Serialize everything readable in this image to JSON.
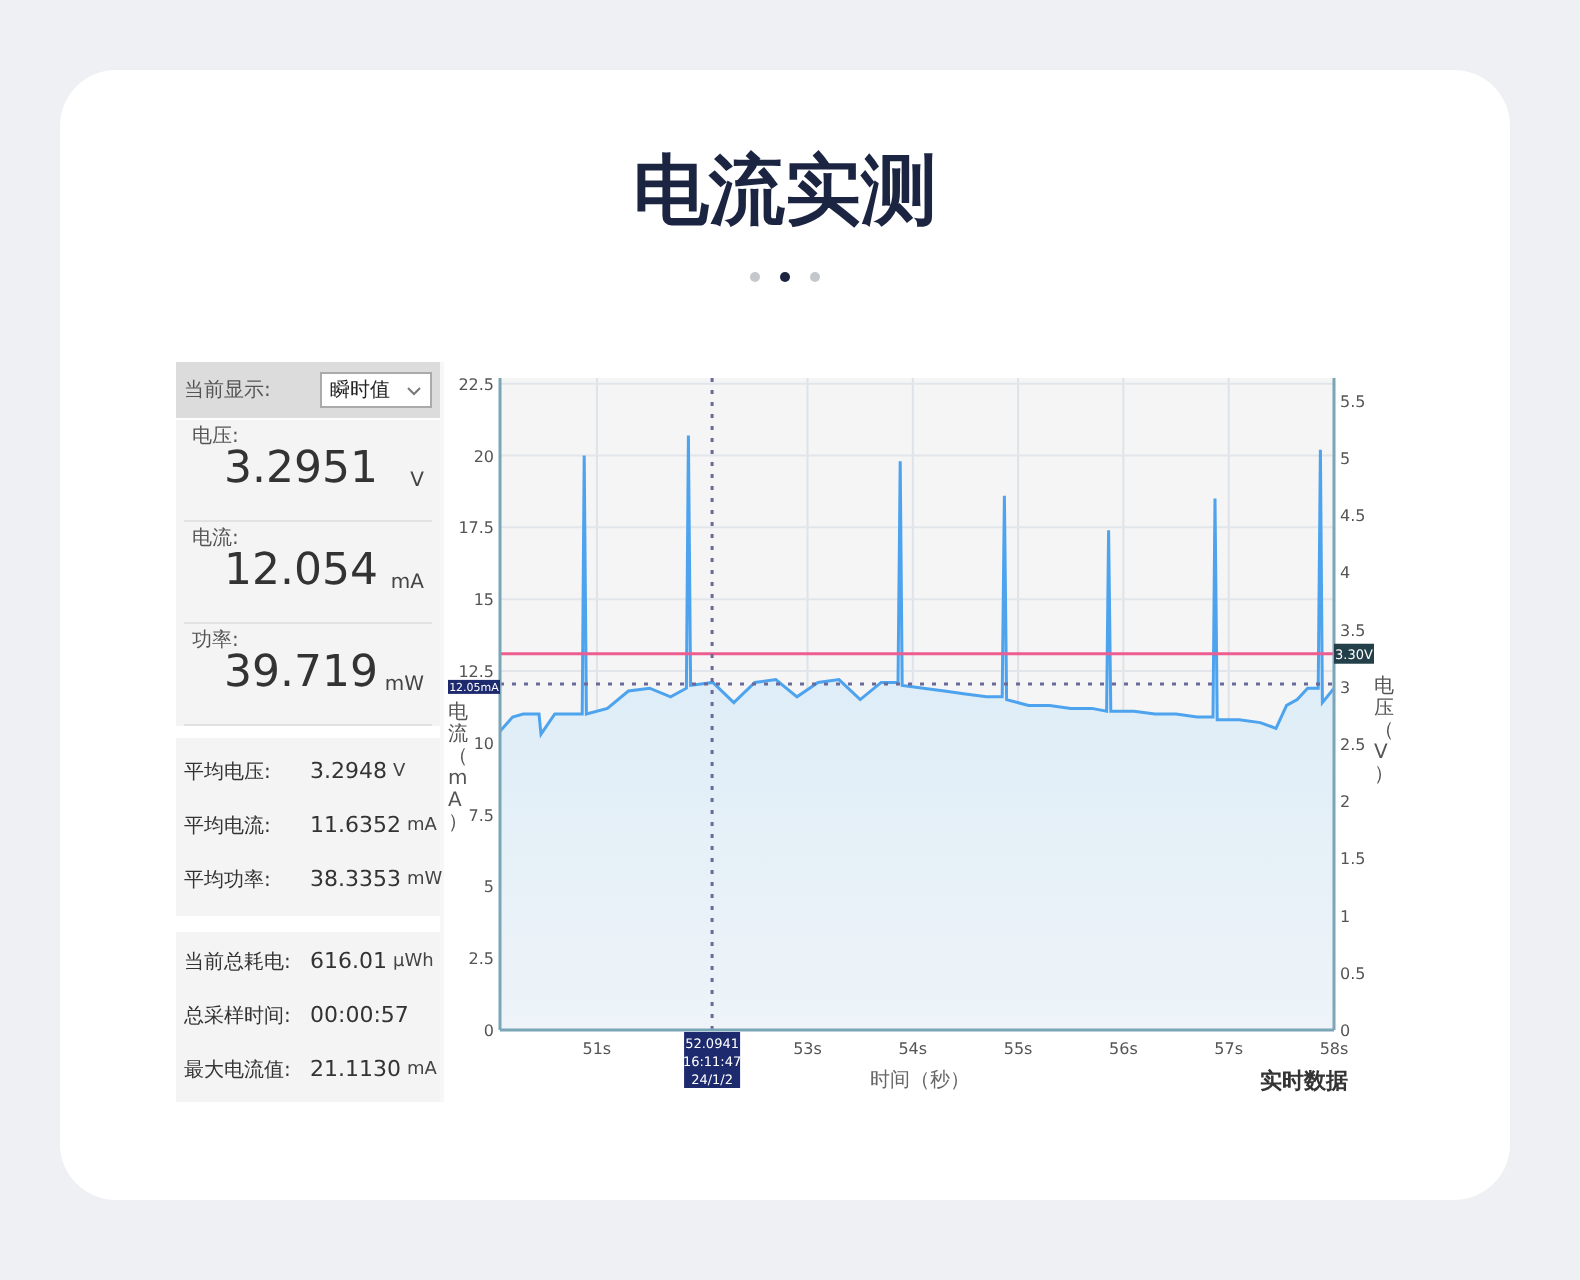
{
  "title": "电流实测",
  "pager": [
    {
      "selected": false
    },
    {
      "selected": true
    },
    {
      "selected": false
    }
  ],
  "panel": {
    "display_label": "当前显示:",
    "display_select": "瞬时值",
    "readings": [
      {
        "label": "电压:",
        "value": "3.2951",
        "unit": "V"
      },
      {
        "label": "电流:",
        "value": "12.054",
        "unit": "mA"
      },
      {
        "label": "功率:",
        "value": "39.719",
        "unit": "mW"
      }
    ],
    "averages": [
      {
        "label": "平均电压:",
        "value": "3.2948",
        "unit": "V"
      },
      {
        "label": "平均电流:",
        "value": "11.6352",
        "unit": "mA"
      },
      {
        "label": "平均功率:",
        "value": "38.3353",
        "unit": "mW"
      }
    ],
    "totals": [
      {
        "label": "当前总耗电:",
        "value": "616.01",
        "unit": "μWh"
      },
      {
        "label": "总采样时间:",
        "value": "00:00:57"
      },
      {
        "label": "最大电流值:",
        "value": "21.1130",
        "unit": "mA"
      }
    ]
  },
  "chart": {
    "legend": "实时数据",
    "chart_data": {
      "type": "area",
      "xlabel": "时间（秒）",
      "ylabel": "电流（mA）",
      "y2label": "电压（V）",
      "x": [
        50.08,
        50.2,
        50.3,
        50.45,
        50.47,
        50.6,
        50.86,
        50.88,
        50.9,
        51.1,
        51.3,
        51.5,
        51.7,
        51.85,
        51.87,
        51.89,
        52.1,
        52.3,
        52.5,
        52.7,
        52.9,
        53.1,
        53.3,
        53.5,
        53.7,
        53.86,
        53.88,
        53.9,
        54.1,
        54.3,
        54.5,
        54.7,
        54.85,
        54.87,
        54.89,
        55.1,
        55.3,
        55.5,
        55.7,
        55.84,
        55.86,
        55.88,
        56.1,
        56.3,
        56.5,
        56.7,
        56.85,
        56.87,
        56.89,
        57.1,
        57.3,
        57.45,
        57.55,
        57.65,
        57.75,
        57.85,
        57.87,
        57.89,
        58
      ],
      "series": [
        {
          "color": "#4da3ee",
          "values": [
            10.4,
            10.9,
            11.0,
            11.0,
            10.3,
            11.0,
            11.0,
            20.0,
            11.0,
            11.2,
            11.8,
            11.9,
            11.6,
            11.9,
            20.7,
            12.0,
            12.1,
            11.4,
            12.1,
            12.2,
            11.6,
            12.1,
            12.2,
            11.5,
            12.1,
            12.1,
            19.8,
            12.0,
            11.9,
            11.8,
            11.7,
            11.6,
            11.6,
            18.6,
            11.5,
            11.3,
            11.3,
            11.2,
            11.2,
            11.1,
            17.4,
            11.1,
            11.1,
            11.0,
            11.0,
            10.9,
            10.9,
            18.5,
            10.8,
            10.8,
            10.7,
            10.5,
            11.3,
            11.5,
            11.9,
            11.9,
            20.2,
            11.4,
            11.9
          ]
        }
      ],
      "grid": true,
      "xlim": [
        50.08,
        58
      ],
      "ylim": [
        0,
        22.7
      ],
      "y2lim": [
        0,
        5.7
      ],
      "xticks": [
        {
          "value": 51,
          "label": "51s"
        },
        {
          "value": 53,
          "label": "53s"
        },
        {
          "value": 54,
          "label": "54s"
        },
        {
          "value": 55,
          "label": "55s"
        },
        {
          "value": 56,
          "label": "56s"
        },
        {
          "value": 57,
          "label": "57s"
        },
        {
          "value": 58,
          "label": "58s"
        }
      ],
      "yticks": [
        0,
        2.5,
        5,
        7.5,
        10,
        {
          "value": 12.5,
          "label": "12.5"
        },
        15,
        17.5,
        20,
        22.5
      ],
      "y2ticks": [
        0,
        0.5,
        1,
        1.5,
        2,
        2.5,
        3,
        3.5,
        4,
        4.5,
        5,
        5.5
      ],
      "ref_lines": [
        {
          "axis": "y",
          "value": 13.1,
          "color": "#ee5d8f",
          "label": "3.30V"
        },
        {
          "axis": "y",
          "value": 12.05,
          "color": "#6a6a9a",
          "label": "12.05mA"
        },
        {
          "axis": "x",
          "value": 52.0941,
          "color": "#6a6a9a",
          "label": "52.0941 16:11:47 24/1/2"
        }
      ]
    }
  }
}
